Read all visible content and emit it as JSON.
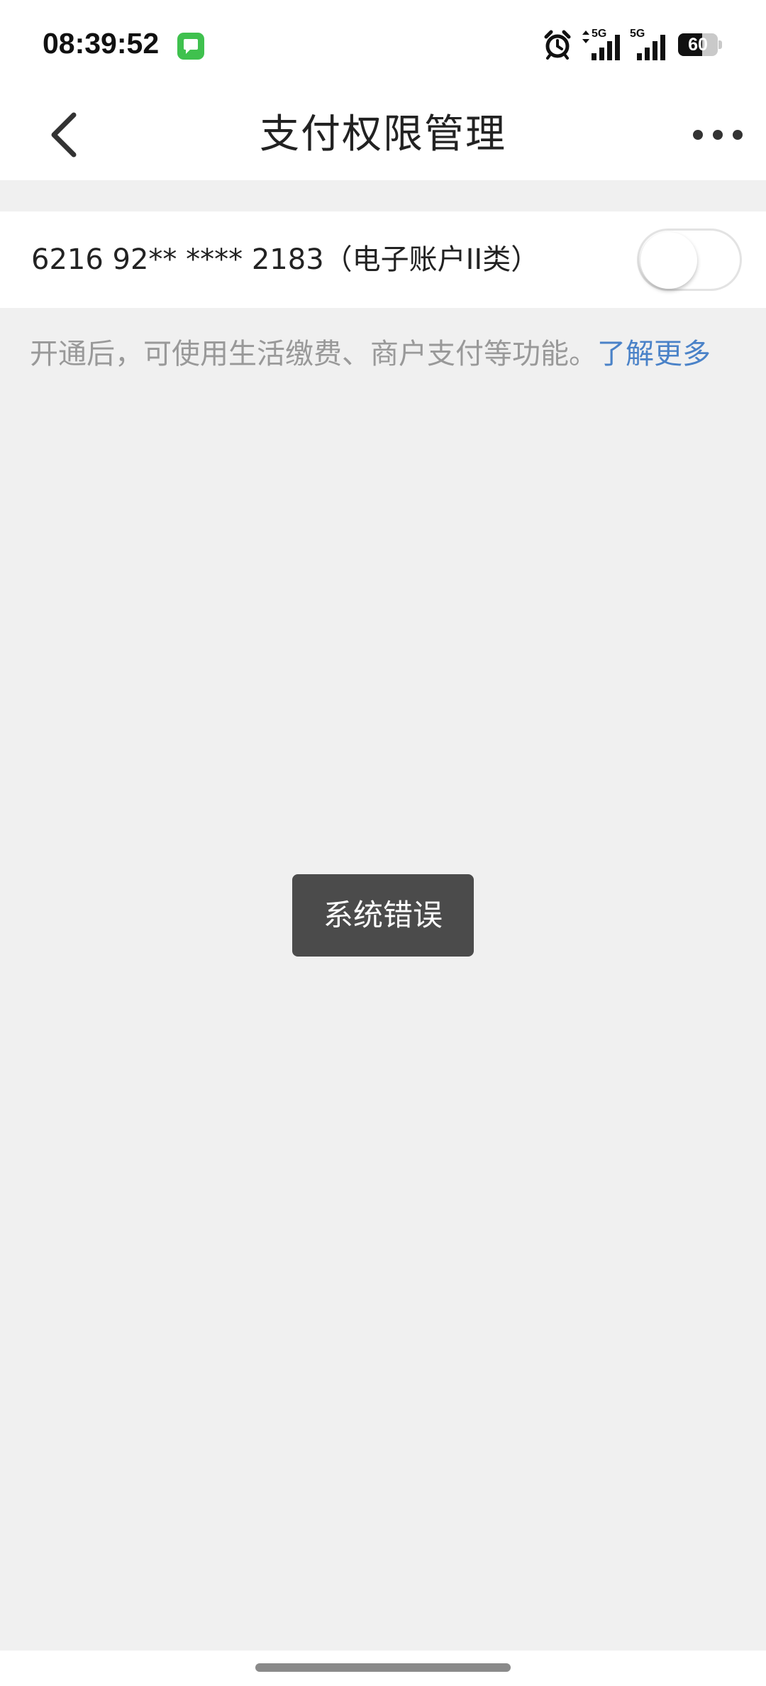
{
  "status_bar": {
    "time": "08:39:52",
    "network_1": "5G",
    "network_2": "5G",
    "battery_percent": "60",
    "battery_level": 0.6,
    "icons": [
      "messages-icon",
      "alarm-icon",
      "data-arrows-icon",
      "signal-icon",
      "signal-icon",
      "battery-icon"
    ]
  },
  "nav": {
    "title": "支付权限管理",
    "back_icon": "chevron-left-icon",
    "more_icon": "more-dots-icon"
  },
  "account": {
    "label": "6216 92** **** 2183（电子账户II类）",
    "toggle_on": false
  },
  "hint": {
    "text": "开通后，可使用生活缴费、商户支付等功能。",
    "link": "了解更多"
  },
  "toast": {
    "text": "系统错误"
  },
  "colors": {
    "background": "#f0f0f0",
    "link": "#4a82c8",
    "toast_bg": "#4b4b4b",
    "messages_icon": "#3fc14e"
  }
}
